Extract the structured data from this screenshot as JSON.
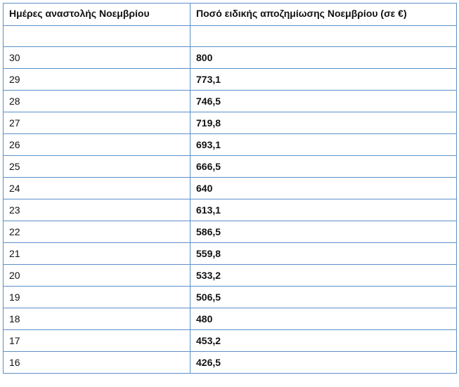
{
  "table": {
    "headers": {
      "days": "Ημέρες αναστολής Νοεμβρίου",
      "amount": "Ποσό ειδικής αποζημίωσης Νοεμβρίου (σε €)"
    },
    "rows": [
      {
        "days": "",
        "amount": ""
      },
      {
        "days": "30",
        "amount": "800"
      },
      {
        "days": "29",
        "amount": "773,1"
      },
      {
        "days": "28",
        "amount": "746,5"
      },
      {
        "days": "27",
        "amount": "719,8"
      },
      {
        "days": "26",
        "amount": "693,1"
      },
      {
        "days": "25",
        "amount": "666,5"
      },
      {
        "days": "24",
        "amount": "640"
      },
      {
        "days": "23",
        "amount": "613,1"
      },
      {
        "days": "22",
        "amount": "586,5"
      },
      {
        "days": "21",
        "amount": "559,8"
      },
      {
        "days": "20",
        "amount": "533,2"
      },
      {
        "days": "19",
        "amount": "506,5"
      },
      {
        "days": "18",
        "amount": "480"
      },
      {
        "days": "17",
        "amount": "453,2"
      },
      {
        "days": "16",
        "amount": "426,5"
      }
    ]
  }
}
